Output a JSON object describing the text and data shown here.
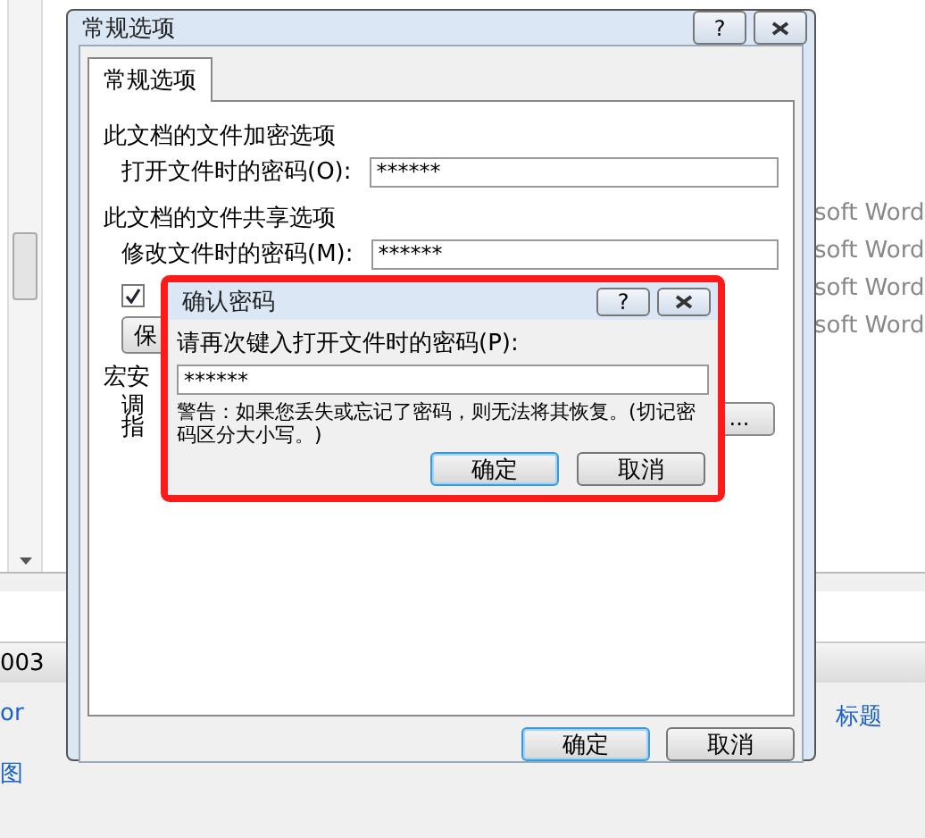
{
  "background": {
    "file_types": [
      "soft Word",
      "soft Word",
      "soft Word",
      "soft Word"
    ],
    "status_text": "003",
    "links": [
      {
        "text": "or"
      },
      {
        "text": "标题"
      },
      {
        "text": "图"
      }
    ]
  },
  "options_dialog": {
    "title": "常规选项",
    "help_button": "?",
    "tabs": [
      {
        "label": "常规选项",
        "selected": true
      }
    ],
    "encryption": {
      "heading": "此文档的文件加密选项",
      "label": "打开文件时的密码(O):",
      "value": "******"
    },
    "sharing": {
      "heading": "此文档的文件共享选项",
      "label": "修改文件时的密码(M):",
      "value": "******"
    },
    "recommend": {
      "checked": true
    },
    "protect_button": "保",
    "macro": {
      "heading": "宏安",
      "lines": [
        "调",
        "指"
      ],
      "button": "..."
    },
    "buttons": [
      {
        "label": "确定",
        "default": true
      },
      {
        "label": "取消",
        "default": false
      }
    ]
  },
  "confirm_dialog": {
    "title": "确认密码",
    "help_button": "?",
    "label": "请再次键入打开文件时的密码(P):",
    "value": "******",
    "warning": "警告：如果您丢失或忘记了密码，则无法将其恢复。(切记密码区分大小写。)",
    "buttons": [
      {
        "label": "确定",
        "default": true
      },
      {
        "label": "取消",
        "default": false
      }
    ],
    "highlighted": true
  }
}
